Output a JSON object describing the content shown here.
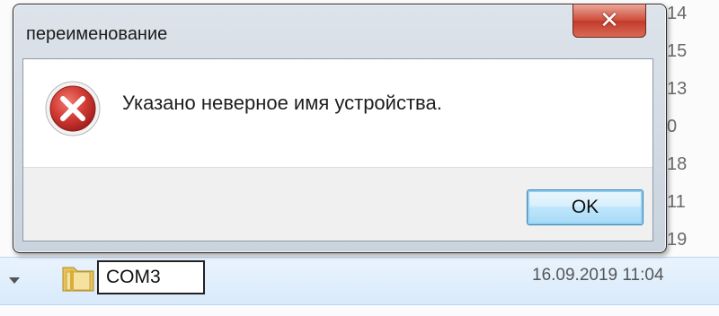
{
  "dialog": {
    "title": "переименование",
    "close_glyph": "✕",
    "message": "Указано неверное имя устройства.",
    "ok_label": "OK",
    "icon": "error-icon"
  },
  "background": {
    "side_numbers": [
      "14",
      "15",
      "13",
      "0",
      "18",
      "11",
      "19"
    ],
    "row": {
      "rename_value": "COM3",
      "date": "16.09.2019 11:04",
      "icon": "folder-icon"
    }
  },
  "colors": {
    "close_red": "#c23a2a",
    "error_red": "#c0262a",
    "ok_border": "#3c7fb1",
    "selection_blue": "#d9eafb"
  }
}
